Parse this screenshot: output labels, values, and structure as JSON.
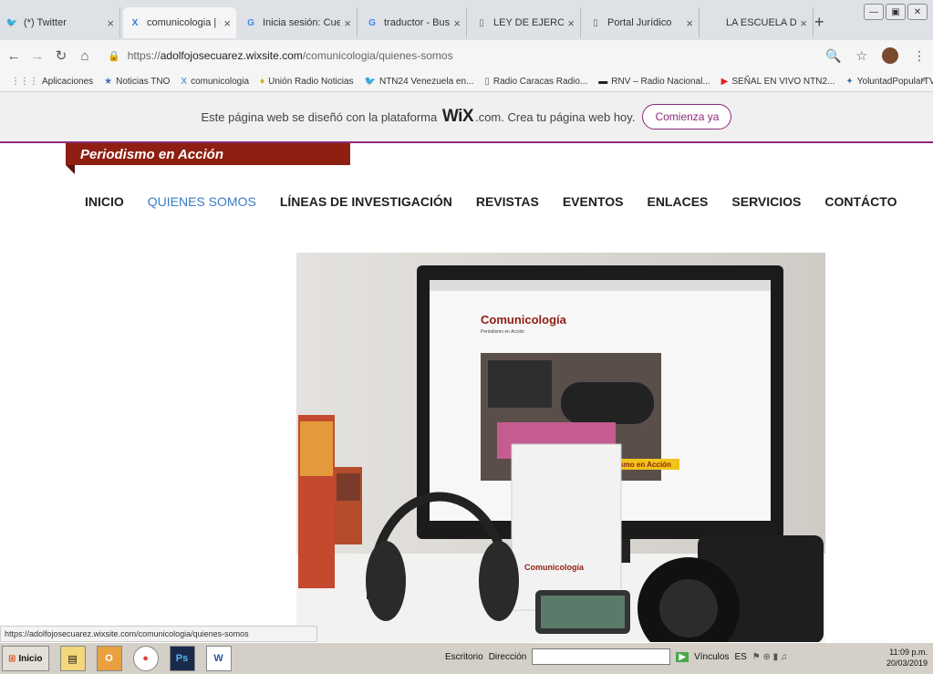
{
  "browser": {
    "tabs": [
      {
        "label": "(*) Twitter",
        "icon": "twitter-icon",
        "color": "#1da1f2",
        "glyph": "🐦"
      },
      {
        "label": "comunicologia | QU",
        "icon": "wix-icon",
        "color": "#2e7ad3",
        "glyph": "X"
      },
      {
        "label": "Inicia sesión: Cuen",
        "icon": "google-icon",
        "color": "#4285f4",
        "glyph": "G"
      },
      {
        "label": "traductor - Buscar",
        "icon": "google-icon",
        "color": "#4285f4",
        "glyph": "G"
      },
      {
        "label": "LEY DE EJERCICIO",
        "icon": "page-icon",
        "color": "#666666",
        "glyph": "▯"
      },
      {
        "label": "Portal Jurídico",
        "icon": "page-icon",
        "color": "#666666",
        "glyph": "▯"
      },
      {
        "label": "LA ESCUELA DE CC",
        "icon": "page-icon",
        "color": "#666666",
        "glyph": ""
      }
    ],
    "new_tab": "+",
    "url_prefix": "https://",
    "url_domain": "adolfojosecuarez.wixsite.com",
    "url_path": "/comunicologia/quienes-somos"
  },
  "bookmarks": [
    {
      "label": "Aplicaciones",
      "glyph": "⋮⋮⋮",
      "color": "#4a8a2a"
    },
    {
      "label": "Noticias TNO",
      "glyph": "★",
      "color": "#3b6fb5"
    },
    {
      "label": "comunicologia",
      "glyph": "X",
      "color": "#2e7ad3"
    },
    {
      "label": "Unión Radio Noticias",
      "glyph": "♦",
      "color": "#d9a21b"
    },
    {
      "label": "NTN24 Venezuela en...",
      "glyph": "🐦",
      "color": "#1da1f2"
    },
    {
      "label": "Radio Caracas Radio...",
      "glyph": "▯",
      "color": "#666"
    },
    {
      "label": "RNV – Radio Nacional...",
      "glyph": "▬",
      "color": "#222"
    },
    {
      "label": "SEÑAL EN VIVO NTN2...",
      "glyph": "▶",
      "color": "#e02020"
    },
    {
      "label": "YoluntadPopularTV en...",
      "glyph": "✦",
      "color": "#3b6fb5"
    }
  ],
  "bookmarks_more": "»",
  "wix_banner": {
    "text_before": "Este página web se diseñó con la plataforma",
    "logo": "WiX",
    "text_after": ".com. Crea tu página web hoy.",
    "cta": "Comienza ya"
  },
  "site": {
    "title": "Periodismo en Acción",
    "nav": [
      "INICIO",
      "QUIENES SOMOS",
      "LÍNEAS DE INVESTIGACIÓN",
      "REVISTAS",
      "EVENTOS",
      "ENLACES",
      "SERVICIOS",
      "CONTÁCTO"
    ],
    "current": 1
  },
  "hero": {
    "screen_title": "Comunicología",
    "screen_subtitle": "Periodismo en Acción",
    "book_title": "Comunicología",
    "banner_text": "ismo en Acción"
  },
  "status_link": "https://adolfojosecuarez.wixsite.com/comunicologia/quienes-somos",
  "taskbar": {
    "start": "Inicio",
    "escritorio": "Escritorio",
    "direccion": "Dirección",
    "vinculos": "Vínculos",
    "lang": "ES",
    "time": "11:09 p.m.",
    "date": "20/03/2019"
  }
}
